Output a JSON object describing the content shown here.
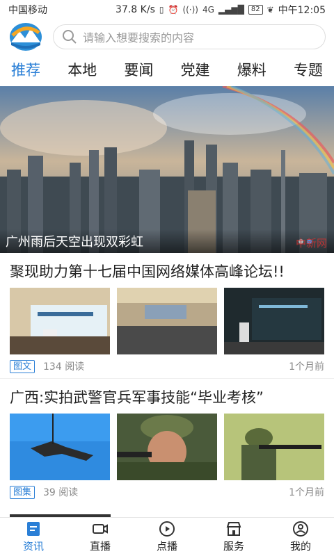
{
  "status": {
    "carrier": "中国移动",
    "speed": "37.8 K/s",
    "network": "4G",
    "battery": "82",
    "time": "中午12:05"
  },
  "search": {
    "placeholder": "请输入想要搜索的内容"
  },
  "tabs": [
    {
      "label": "推荐",
      "active": true
    },
    {
      "label": "本地",
      "active": false
    },
    {
      "label": "要闻",
      "active": false
    },
    {
      "label": "党建",
      "active": false
    },
    {
      "label": "爆料",
      "active": false
    },
    {
      "label": "专题",
      "active": false
    }
  ],
  "banner": {
    "caption": "广州雨后天空出现双彩虹",
    "watermark": "中新网",
    "dots": 2
  },
  "articles": [
    {
      "title": "聚现助力第十七届中国网络媒体高峰论坛!!",
      "tag": "图文",
      "reads": "134 阅读",
      "time": "1个月前"
    },
    {
      "title": "广西:实拍武警官兵军事技能“毕业考核”",
      "tag": "图集",
      "reads": "39 阅读",
      "time": "1个月前"
    }
  ],
  "nav": [
    {
      "label": "资讯",
      "icon": "news-icon",
      "active": true
    },
    {
      "label": "直播",
      "icon": "live-icon",
      "active": false
    },
    {
      "label": "点播",
      "icon": "play-icon",
      "active": false
    },
    {
      "label": "服务",
      "icon": "store-icon",
      "active": false
    },
    {
      "label": "我的",
      "icon": "user-icon",
      "active": false
    }
  ],
  "colors": {
    "accent": "#2a7fd6"
  }
}
